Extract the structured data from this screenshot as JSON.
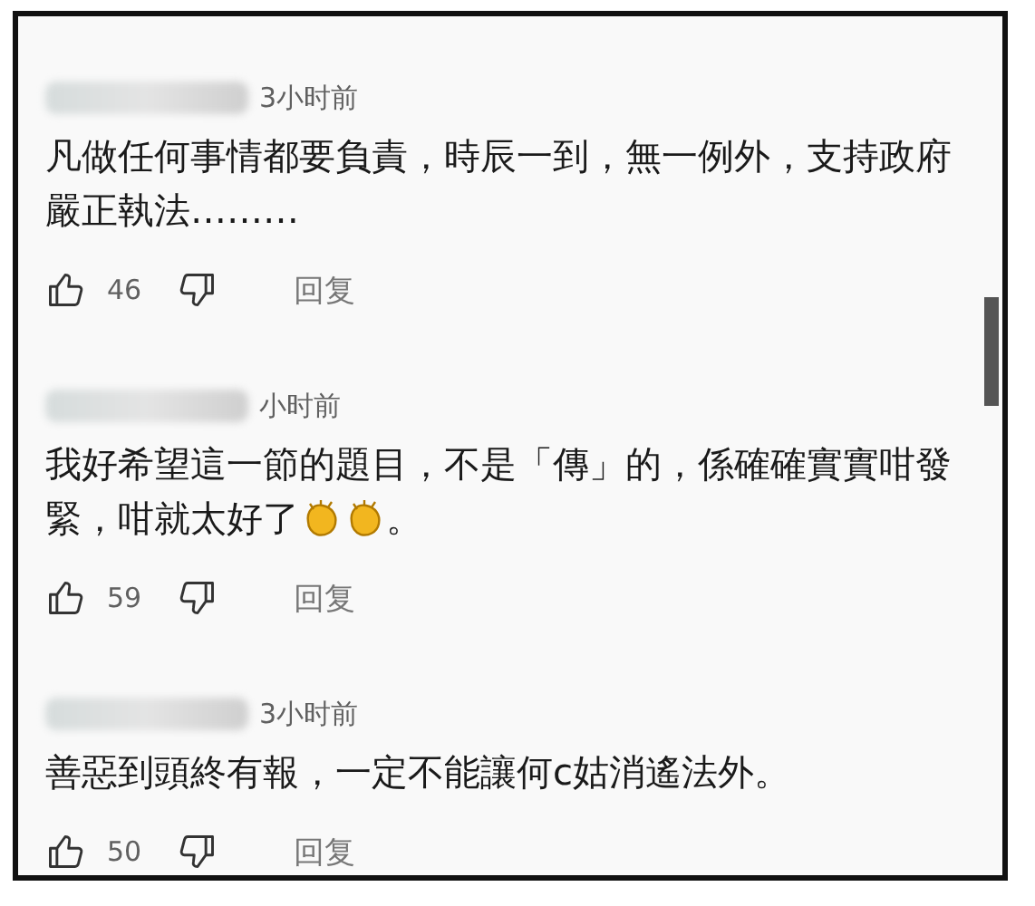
{
  "comments": [
    {
      "author_blurred": true,
      "time": "3小时前",
      "lines": [
        [
          {
            "kind": "text",
            "text": "凡做任何事情都要負責，時辰一到，無一例外，支持政府"
          }
        ],
        [
          {
            "kind": "text",
            "text": "嚴正執法………"
          }
        ]
      ],
      "likes": "46",
      "reply": "回复"
    },
    {
      "author_blurred": true,
      "time": "小时前",
      "lines": [
        [
          {
            "kind": "text",
            "text": "我好希望這一節的題目，不是「傳」的，係確確實實咁發"
          }
        ],
        [
          {
            "kind": "text",
            "text": "緊，咁就太好了"
          },
          {
            "kind": "emoji"
          },
          {
            "kind": "emoji"
          },
          {
            "kind": "text",
            "text": "。"
          }
        ]
      ],
      "likes": "59",
      "reply": "回复"
    },
    {
      "author_blurred": true,
      "time": "3小时前",
      "lines": [
        [
          {
            "kind": "text",
            "text": "善惡到頭終有報，一定不能讓何c姑消遙法外。"
          }
        ]
      ],
      "likes": "50",
      "reply": "回复"
    }
  ]
}
